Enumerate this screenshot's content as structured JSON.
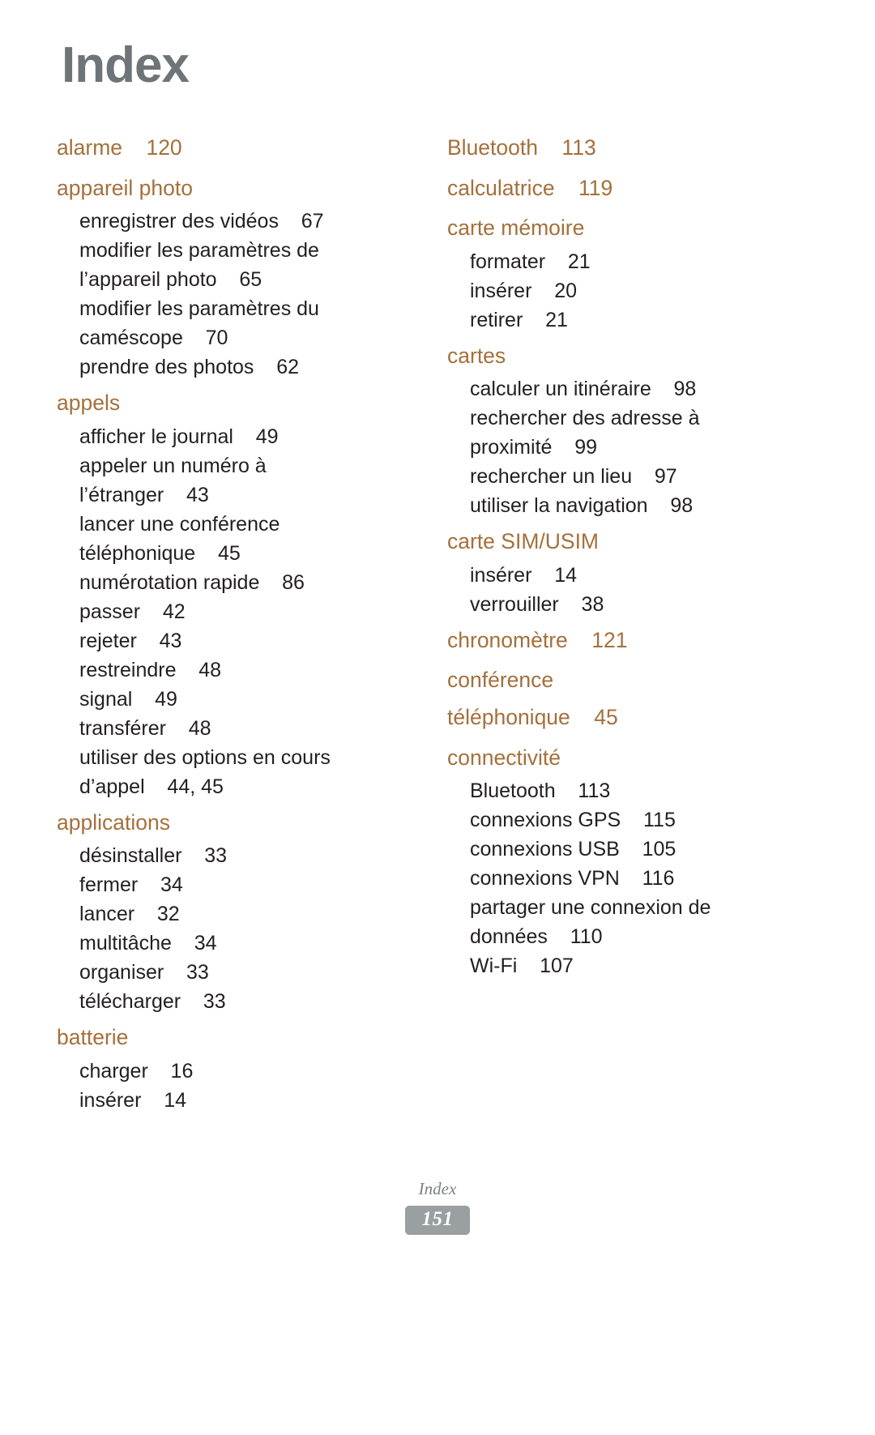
{
  "page": {
    "title": "Index",
    "title_color": "#6e7477",
    "main_entry_color": "#a4703c",
    "sub_entry_color": "#231f20",
    "background": "#ffffff"
  },
  "footer": {
    "label": "Index",
    "page_number": "151",
    "badge_color": "#9a9fa2"
  },
  "columns": [
    {
      "entries": [
        {
          "term": "alarme",
          "pages": "120",
          "main_line": "alarme    120",
          "subentries": []
        },
        {
          "term": "appareil photo",
          "pages": "",
          "main_line": "appareil photo",
          "subentries": [
            {
              "term": "enregistrer des vidéos",
              "pages": "67",
              "line": "enregistrer des vidéos    67"
            },
            {
              "term": "modifier les paramètres de l’appareil photo",
              "pages": "65",
              "line": "modifier les paramètres de\nl’appareil photo    65"
            },
            {
              "term": "modifier les paramètres du caméscope",
              "pages": "70",
              "line": "modifier les paramètres du\ncaméscope    70"
            },
            {
              "term": "prendre des photos",
              "pages": "62",
              "line": "prendre des photos    62"
            }
          ]
        },
        {
          "term": "appels",
          "pages": "",
          "main_line": "appels",
          "subentries": [
            {
              "term": "afficher le journal",
              "pages": "49",
              "line": "afficher le journal    49"
            },
            {
              "term": "appeler un numéro à l’étranger",
              "pages": "43",
              "line": "appeler un numéro à\nl’étranger    43"
            },
            {
              "term": "lancer une conférence téléphonique",
              "pages": "45",
              "line": "lancer une conférence\ntéléphonique    45"
            },
            {
              "term": "numérotation rapide",
              "pages": "86",
              "line": "numérotation rapide    86"
            },
            {
              "term": "passer",
              "pages": "42",
              "line": "passer    42"
            },
            {
              "term": "rejeter",
              "pages": "43",
              "line": "rejeter    43"
            },
            {
              "term": "restreindre",
              "pages": "48",
              "line": "restreindre    48"
            },
            {
              "term": "signal",
              "pages": "49",
              "line": "signal    49"
            },
            {
              "term": "transférer",
              "pages": "48",
              "line": "transférer    48"
            },
            {
              "term": "utiliser des options en cours d’appel",
              "pages": "44, 45",
              "line": "utiliser des options en cours\nd’appel    44, 45"
            }
          ]
        },
        {
          "term": "applications",
          "pages": "",
          "main_line": "applications",
          "subentries": [
            {
              "term": "désinstaller",
              "pages": "33",
              "line": "désinstaller    33"
            },
            {
              "term": "fermer",
              "pages": "34",
              "line": "fermer    34"
            },
            {
              "term": "lancer",
              "pages": "32",
              "line": "lancer    32"
            },
            {
              "term": "multitâche",
              "pages": "34",
              "line": "multitâche    34"
            },
            {
              "term": "organiser",
              "pages": "33",
              "line": "organiser    33"
            },
            {
              "term": "télécharger",
              "pages": "33",
              "line": "télécharger    33"
            }
          ]
        },
        {
          "term": "batterie",
          "pages": "",
          "main_line": "batterie",
          "subentries": [
            {
              "term": "charger",
              "pages": "16",
              "line": "charger    16"
            },
            {
              "term": "insérer",
              "pages": "14",
              "line": "insérer    14"
            }
          ]
        }
      ]
    },
    {
      "entries": [
        {
          "term": "Bluetooth",
          "pages": "113",
          "main_line": "Bluetooth    113",
          "subentries": []
        },
        {
          "term": "calculatrice",
          "pages": "119",
          "main_line": "calculatrice    119",
          "subentries": []
        },
        {
          "term": "carte mémoire",
          "pages": "",
          "main_line": "carte mémoire",
          "subentries": [
            {
              "term": "formater",
              "pages": "21",
              "line": "formater    21"
            },
            {
              "term": "insérer",
              "pages": "20",
              "line": "insérer    20"
            },
            {
              "term": "retirer",
              "pages": "21",
              "line": "retirer    21"
            }
          ]
        },
        {
          "term": "cartes",
          "pages": "",
          "main_line": "cartes",
          "subentries": [
            {
              "term": "calculer un itinéraire",
              "pages": "98",
              "line": "calculer un itinéraire    98"
            },
            {
              "term": "rechercher des adresse à proximité",
              "pages": "99",
              "line": "rechercher des adresse à\nproximité    99"
            },
            {
              "term": "rechercher un lieu",
              "pages": "97",
              "line": "rechercher un lieu    97"
            },
            {
              "term": "utiliser la navigation",
              "pages": "98",
              "line": "utiliser la navigation    98"
            }
          ]
        },
        {
          "term": "carte SIM/USIM",
          "pages": "",
          "main_line": "carte SIM/USIM",
          "subentries": [
            {
              "term": "insérer",
              "pages": "14",
              "line": "insérer    14"
            },
            {
              "term": "verrouiller",
              "pages": "38",
              "line": "verrouiller    38"
            }
          ]
        },
        {
          "term": "chronomètre",
          "pages": "121",
          "main_line": "chronomètre    121",
          "subentries": []
        },
        {
          "term": "conférence téléphonique",
          "pages": "45",
          "main_line": "conférence\ntéléphonique    45",
          "subentries": []
        },
        {
          "term": "connectivité",
          "pages": "",
          "main_line": "connectivité",
          "subentries": [
            {
              "term": "Bluetooth",
              "pages": "113",
              "line": "Bluetooth    113"
            },
            {
              "term": "connexions GPS",
              "pages": "115",
              "line": "connexions GPS    115"
            },
            {
              "term": "connexions USB",
              "pages": "105",
              "line": "connexions USB    105"
            },
            {
              "term": "connexions VPN",
              "pages": "116",
              "line": "connexions VPN    116"
            },
            {
              "term": "partager une connexion de données",
              "pages": "110",
              "line": "partager une connexion de\ndonnées    110"
            },
            {
              "term": "Wi-Fi",
              "pages": "107",
              "line": "Wi-Fi    107"
            }
          ]
        }
      ]
    }
  ]
}
